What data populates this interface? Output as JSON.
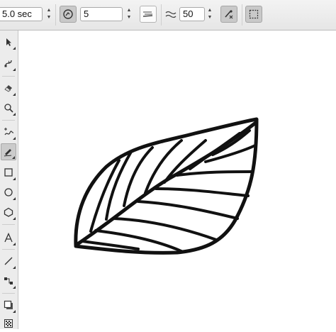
{
  "property_bar": {
    "duration_value": "5.0 sec",
    "smoothing_value": "5",
    "strength_value": "50"
  },
  "icons": {
    "duration_spinner": "spinner-arrows-icon",
    "pressure_toggle": "pressure-dial-icon",
    "bristle_style": "brush-stroke-preview-icon",
    "smoothing_wave": "wave-approximate-icon",
    "brush_settings": "brush-settings-icon",
    "bounding_box": "bounding-box-icon"
  },
  "toolbox": {
    "tools": [
      "pick-tool-icon",
      "shape-tool-icon",
      "eraser-tool-icon",
      "zoom-tool-icon",
      "freehand-tool-icon",
      "artistic-media-tool-icon",
      "rectangle-tool-icon",
      "ellipse-tool-icon",
      "polygon-tool-icon",
      "text-tool-icon",
      "line-tool-icon",
      "connector-tool-icon",
      "drop-shadow-tool-icon",
      "fill-tool-icon"
    ],
    "active_tool": "artistic-media-tool-icon"
  },
  "colors": {
    "toolbar_bg": "#ececec",
    "canvas_bg": "#ffffff",
    "stroke": "#111111"
  }
}
